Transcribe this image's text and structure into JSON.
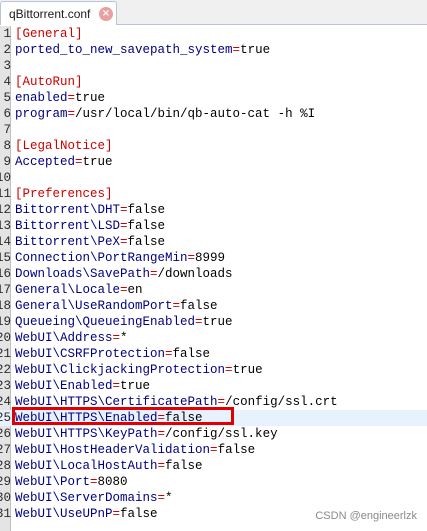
{
  "tab": {
    "title": "qBittorrent.conf",
    "close_icon": "close-icon"
  },
  "lines": [
    {
      "num": "1",
      "type": "section",
      "text": "[General]"
    },
    {
      "num": "2",
      "type": "kv",
      "key": "ported_to_new_savepath_system",
      "value": "true"
    },
    {
      "num": "3",
      "type": "empty"
    },
    {
      "num": "4",
      "type": "section",
      "text": "[AutoRun]"
    },
    {
      "num": "5",
      "type": "kv",
      "key": "enabled",
      "value": "true"
    },
    {
      "num": "6",
      "type": "kv",
      "key": "program",
      "value": "/usr/local/bin/qb-auto-cat -h %I"
    },
    {
      "num": "7",
      "type": "empty"
    },
    {
      "num": "8",
      "type": "section",
      "text": "[LegalNotice]"
    },
    {
      "num": "9",
      "type": "kv",
      "key": "Accepted",
      "value": "true"
    },
    {
      "num": "10",
      "type": "empty"
    },
    {
      "num": "11",
      "type": "section",
      "text": "[Preferences]"
    },
    {
      "num": "12",
      "type": "kv",
      "key": "Bittorrent\\DHT",
      "value": "false"
    },
    {
      "num": "13",
      "type": "kv",
      "key": "Bittorrent\\LSD",
      "value": "false"
    },
    {
      "num": "14",
      "type": "kv",
      "key": "Bittorrent\\PeX",
      "value": "false"
    },
    {
      "num": "15",
      "type": "kv",
      "key": "Connection\\PortRangeMin",
      "value": "8999"
    },
    {
      "num": "16",
      "type": "kv",
      "key": "Downloads\\SavePath",
      "value": "/downloads"
    },
    {
      "num": "17",
      "type": "kv",
      "key": "General\\Locale",
      "value": "en"
    },
    {
      "num": "18",
      "type": "kv",
      "key": "General\\UseRandomPort",
      "value": "false"
    },
    {
      "num": "19",
      "type": "kv",
      "key": "Queueing\\QueueingEnabled",
      "value": "true"
    },
    {
      "num": "20",
      "type": "kv",
      "key": "WebUI\\Address",
      "value": "*"
    },
    {
      "num": "21",
      "type": "kv",
      "key": "WebUI\\CSRFProtection",
      "value": "false"
    },
    {
      "num": "22",
      "type": "kv",
      "key": "WebUI\\ClickjackingProtection",
      "value": "true"
    },
    {
      "num": "23",
      "type": "kv",
      "key": "WebUI\\Enabled",
      "value": "true"
    },
    {
      "num": "24",
      "type": "kv",
      "key": "WebUI\\HTTPS\\CertificatePath",
      "value": "/config/ssl.crt"
    },
    {
      "num": "25",
      "type": "kv",
      "key": "WebUI\\HTTPS\\Enabled",
      "value": "false",
      "current": true
    },
    {
      "num": "26",
      "type": "kv",
      "key": "WebUI\\HTTPS\\KeyPath",
      "value": "/config/ssl.key"
    },
    {
      "num": "27",
      "type": "kv",
      "key": "WebUI\\HostHeaderValidation",
      "value": "false"
    },
    {
      "num": "28",
      "type": "kv",
      "key": "WebUI\\LocalHostAuth",
      "value": "false"
    },
    {
      "num": "29",
      "type": "kv",
      "key": "WebUI\\Port",
      "value": "8080"
    },
    {
      "num": "30",
      "type": "kv",
      "key": "WebUI\\ServerDomains",
      "value": "*"
    },
    {
      "num": "31",
      "type": "kv",
      "key": "WebUI\\UseUPnP",
      "value": "false"
    }
  ],
  "watermark": "CSDN @engineerlzk",
  "colors": {
    "key": "#000080",
    "equals": "#cc0000",
    "section": "#cc0000",
    "highlight_border": "#e00000",
    "current_line": "#e8f2ff"
  }
}
